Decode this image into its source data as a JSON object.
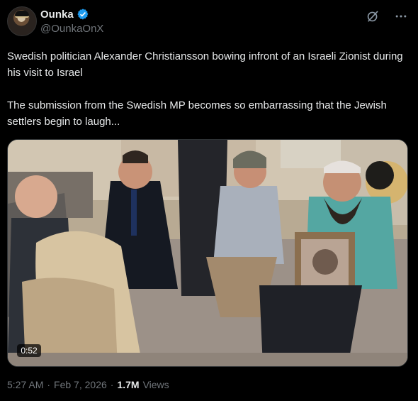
{
  "author": {
    "display_name": "Ounka",
    "handle": "@OunkaOnX",
    "verified": true,
    "avatar_icon": "profile-avatar"
  },
  "header_icons": [
    "grok-icon",
    "more-icon"
  ],
  "post": {
    "text": "Swedish politician Alexander Christiansson bowing infront of an Israeli Zionist during his visit to Israel\n\nThe submission from the Swedish MP becomes so embarrassing that the Jewish settlers begin to laugh..."
  },
  "video": {
    "duration": "0:52"
  },
  "meta": {
    "time": "5:27 AM",
    "date": "Feb 7, 2026",
    "separator": "·",
    "views_count": "1.7M",
    "views_label": "Views"
  },
  "colors": {
    "background": "#000000",
    "text": "#e7e9ea",
    "secondary": "#71767b",
    "verified": "#1d9bf0"
  }
}
